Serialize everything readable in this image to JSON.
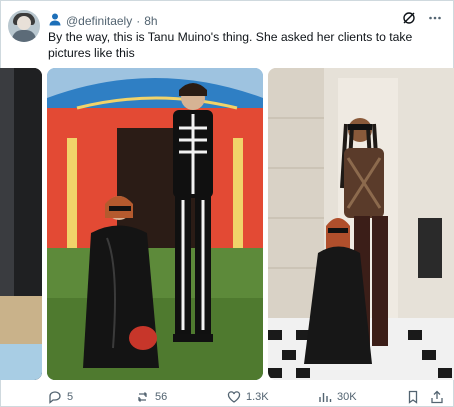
{
  "post": {
    "handle": "@definitaely",
    "separator": "·",
    "time": "8h",
    "text": "By the way, this is Tanu Muino's thing. She asked her clients to take pictures like this"
  },
  "actions": {
    "replies": "5",
    "reposts": "56",
    "likes": "1.3K",
    "views": "30K"
  },
  "icons": [
    "user-icon",
    "grok-icon",
    "more-icon",
    "reply-icon",
    "repost-icon",
    "like-icon",
    "views-icon",
    "bookmark-icon",
    "share-icon"
  ],
  "colors": {
    "text": "#0f1419",
    "secondary": "#536471",
    "border": "#cfd9de",
    "accent": "#1d6fb8"
  }
}
